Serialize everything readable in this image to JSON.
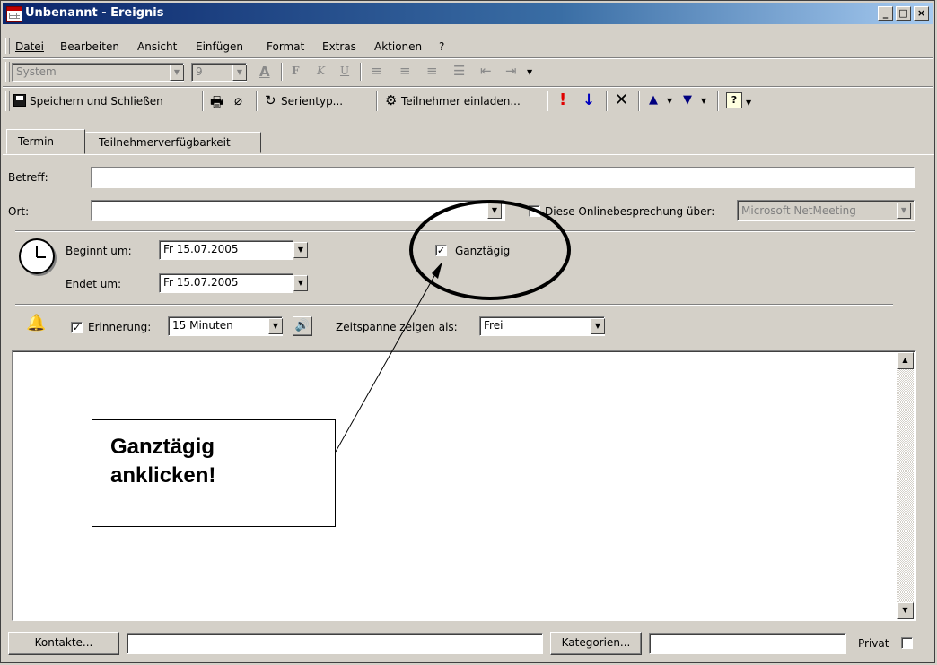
{
  "window": {
    "title": "Unbenannt - Ereignis",
    "buttons": [
      "_",
      "□",
      "×"
    ]
  },
  "menu": [
    "Datei",
    "Bearbeiten",
    "Ansicht",
    "Einfügen",
    "Format",
    "Extras",
    "Aktionen",
    "?"
  ],
  "format_toolbar": {
    "font": "System",
    "size": "9"
  },
  "toolbar": {
    "save_close": "Speichern und Schließen",
    "series": "Serientyp...",
    "invite": "Teilnehmer einladen..."
  },
  "tabs": [
    "Termin",
    "Teilnehmerverfügbarkeit"
  ],
  "form": {
    "subject_label": "Betreff:",
    "subject_value": "",
    "location_label": "Ort:",
    "location_value": "",
    "online_label": "Diese Onlinebesprechung über:",
    "online_value": "Microsoft NetMeeting",
    "start_label": "Beginnt um:",
    "start_date": "Fr 15.07.2005",
    "end_label": "Endet um:",
    "end_date": "Fr 15.07.2005",
    "allday_label": "Ganztägig",
    "allday_checked": true,
    "reminder_label": "Erinnerung:",
    "reminder_value": "15 Minuten",
    "reminder_checked": true,
    "showas_label": "Zeitspanne zeigen als:",
    "showas_value": "Frei"
  },
  "annotation": {
    "line1": "Ganztägig",
    "line2": "anklicken!"
  },
  "footer": {
    "contacts_button": "Kontakte...",
    "contacts_value": "",
    "categories_button": "Kategorien...",
    "categories_value": "",
    "private_label": "Privat",
    "private_checked": false
  }
}
